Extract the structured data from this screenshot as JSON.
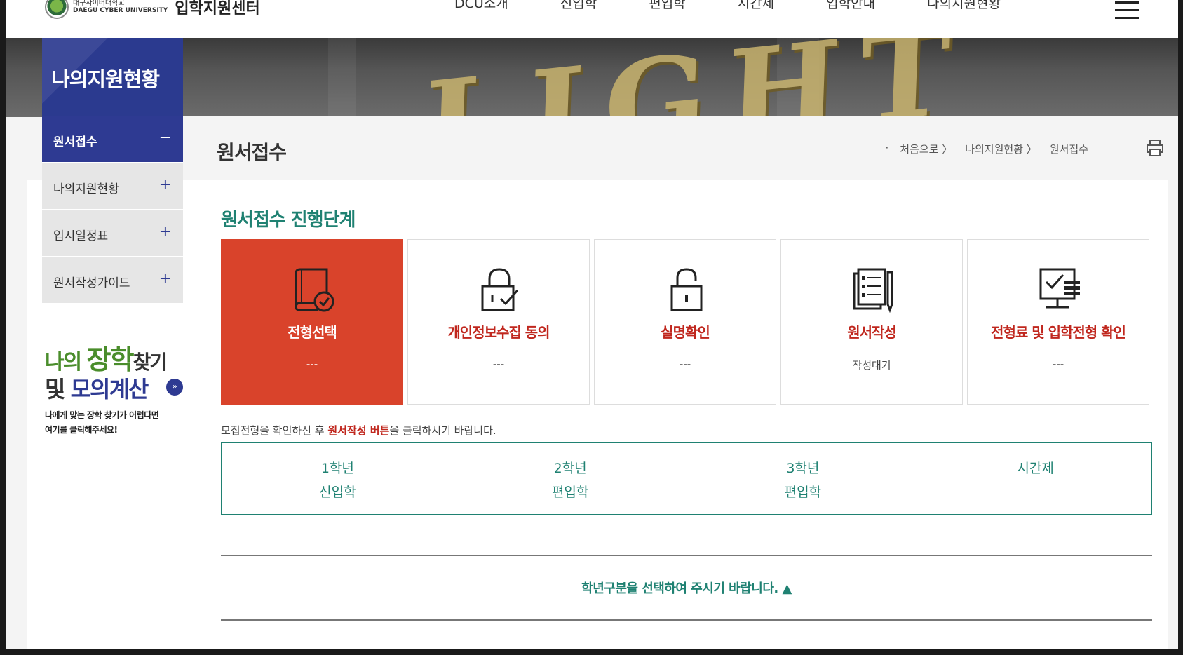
{
  "header": {
    "logo_small_1": "대구사이버대학교",
    "logo_small_2": "DAEGU CYBER UNIVERSITY",
    "logo_title": "입학지원센터",
    "nav": [
      "DCU소개",
      "신입학",
      "편입학",
      "시간제",
      "입학안내",
      "나의지원현황"
    ]
  },
  "banner": {
    "sign_text": "LIGHT"
  },
  "sidebar": {
    "title": "나의지원현황",
    "items": [
      {
        "label": "원서접수",
        "toggle": "−"
      },
      {
        "label": "나의지원현황",
        "toggle": "+"
      },
      {
        "label": "입시일정표",
        "toggle": "+"
      },
      {
        "label": "원서작성가이드",
        "toggle": "+"
      }
    ],
    "promo": {
      "line1_a": "나의 ",
      "line1_b": "장학",
      "line1_c": "찾기",
      "line2_a": "및 ",
      "line2_b": "모의계산",
      "arrow": "»",
      "desc1": "나에게 맞는 장학 찾기가 어렵다면",
      "desc2": "여기를 클릭해주세요!"
    }
  },
  "main": {
    "page_title": "원서접수",
    "breadcrumb": [
      "처음으로",
      "나의지원현황",
      "원서접수"
    ],
    "section_title": "원서접수 진행단계",
    "steps": [
      {
        "name": "전형선택",
        "state": "---"
      },
      {
        "name": "개인정보수집 동의",
        "state": "---"
      },
      {
        "name": "실명확인",
        "state": "---"
      },
      {
        "name": "원서작성",
        "state": "작성대기"
      },
      {
        "name": "전형료 및 입학전형 확인",
        "state": "---"
      }
    ],
    "notice_a": "모집전형을 확인하신 후 ",
    "notice_hl": "원서작성 버튼",
    "notice_b": "을 클릭하시기 바랍니다.",
    "grades": [
      {
        "line1": "1학년",
        "line2": "신입학"
      },
      {
        "line1": "2학년",
        "line2": "편입학"
      },
      {
        "line1": "3학년",
        "line2": "편입학"
      },
      {
        "line1": "시간제",
        "line2": ""
      }
    ],
    "select_message": "학년구분을 선택하여 주시기 바랍니다. ▲"
  },
  "colors": {
    "primary_blue": "#2e3a92",
    "accent_red": "#d9432b",
    "teal": "#1f8172"
  }
}
